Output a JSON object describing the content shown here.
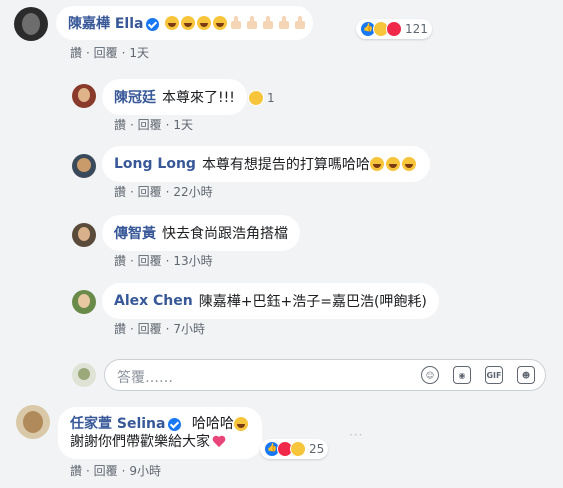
{
  "comments": [
    {
      "id": "c1",
      "author": "陳嘉樺 Ella",
      "verified": true,
      "text": "",
      "emojis": [
        "rofl",
        "rofl",
        "rofl",
        "rofl",
        "thumb",
        "thumb",
        "thumb",
        "thumb",
        "thumb"
      ],
      "reactions": {
        "types": [
          "like",
          "haha",
          "love"
        ],
        "count": "121"
      },
      "actions": {
        "like": "讚",
        "reply": "回覆",
        "time": "1天"
      }
    }
  ],
  "replies": [
    {
      "author": "陳冠廷",
      "text": "本尊來了!!!",
      "reactions": {
        "types": [
          "haha"
        ],
        "count": "1"
      },
      "actions": {
        "like": "讚",
        "reply": "回覆",
        "time": "1天"
      }
    },
    {
      "author": "Long Long",
      "text": "本尊有想提告的打算嗎哈哈",
      "emojis": 3,
      "actions": {
        "like": "讚",
        "reply": "回覆",
        "time": "22小時"
      }
    },
    {
      "author": "傳智黃",
      "text": "快去食尚跟浩角搭檔",
      "actions": {
        "like": "讚",
        "reply": "回覆",
        "time": "13小時"
      }
    },
    {
      "author": "Alex Chen",
      "text": "陳嘉樺+巴鈺+浩子=嘉巴浩(呷飽耗)",
      "actions": {
        "like": "讚",
        "reply": "回覆",
        "time": "7小時"
      }
    }
  ],
  "reply_box": {
    "placeholder": "答覆……"
  },
  "comment2": {
    "author": "任家萱 Selina",
    "verified": true,
    "text_line1": "哈哈哈",
    "text_line2": "謝謝你們帶歡樂給大家",
    "reactions": {
      "types": [
        "like",
        "love",
        "haha"
      ],
      "count": "25"
    },
    "actions": {
      "like": "讚",
      "reply": "回覆",
      "time": "9小時"
    }
  },
  "colors": {
    "link": "#385898",
    "background": "#f2f3f5",
    "like": "#1877f2",
    "love": "#f0284a",
    "haha": "#f7c53b"
  }
}
